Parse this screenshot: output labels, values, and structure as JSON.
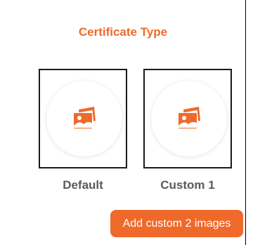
{
  "dialog": {
    "title": "Certificate Type"
  },
  "options": [
    {
      "label": "Default",
      "icon": "image-gallery-icon"
    },
    {
      "label": "Custom 1",
      "icon": "image-gallery-icon"
    }
  ],
  "add_button": {
    "label": "Add custom 2 images"
  },
  "colors": {
    "accent": "#ef6a2a",
    "label_gray": "#5a5a5a"
  }
}
